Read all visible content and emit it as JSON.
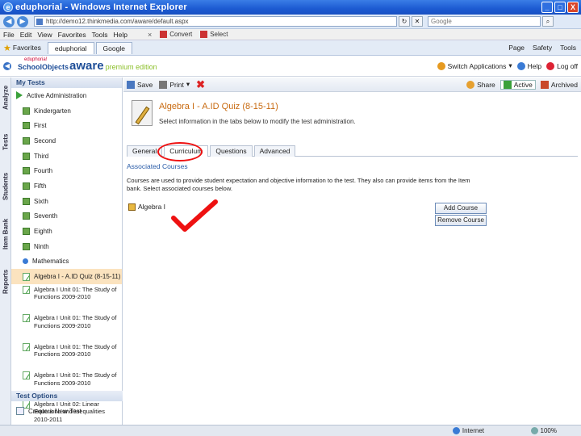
{
  "window": {
    "title": "eduphorial - Windows Internet Explorer",
    "btn_min": "_",
    "btn_max": "□",
    "btn_close": "X"
  },
  "address": {
    "url": "http://demo12.thinkmedia.com/aware/default.aspx",
    "search_placeholder": "Google"
  },
  "menu": {
    "items": [
      "File",
      "Edit",
      "View",
      "Favorites",
      "Tools",
      "Help"
    ],
    "close_x": "×",
    "convert": "Convert",
    "select": "Select"
  },
  "favorites": {
    "label": "Favorites",
    "tabs": [
      "eduphorial",
      "Google"
    ],
    "right": [
      "Page",
      "Safety",
      "Tools"
    ]
  },
  "header": {
    "logo_small": "eduphoria!",
    "logo_school": "SchoolObjects",
    "logo_aware": "aware",
    "logo_edition": "premium edition",
    "switch_apps": "Switch Applications",
    "help": "Help",
    "logoff": "Log off"
  },
  "vtabs": [
    "Analyze",
    "Tests",
    "Students",
    "Item Bank",
    "Reports"
  ],
  "sidebar": {
    "title": "My Tests",
    "active": "Active Administration",
    "folders": [
      "Kindergarten",
      "First",
      "Second",
      "Third",
      "Fourth",
      "Fifth",
      "Sixth",
      "Seventh",
      "Eighth",
      "Ninth"
    ],
    "subject": "Mathematics",
    "quizzes": [
      "Algebra I - A.ID Quiz (8-15-11)",
      "Algebra I Unit 01: The Study of Functions 2009-2010",
      "Algebra I Unit 01: The Study of Functions 2009-2010",
      "Algebra I Unit 01: The Study of Functions 2009-2010",
      "Algebra I Unit 01: The Study of Functions 2009-2010",
      "Algebra I Unit 02: Linear Equations and Inequalities 2010-2011"
    ],
    "options_title": "Test Options",
    "create": "Create a New Test"
  },
  "toolbar": {
    "save": "Save",
    "print": "Print",
    "share": "Share",
    "active": "Active",
    "archived": "Archived"
  },
  "main": {
    "test_title": "Algebra I - A.ID Quiz (8-15-11)",
    "subtitle": "Select information in the tabs below to modify the test administration.",
    "tabs": [
      "General",
      "Curriculum",
      "Questions",
      "Advanced"
    ],
    "section_title": "Associated Courses",
    "description": "Courses are used to provide student expectation and objective information to the test. They also can provide items from the Item bank. Select associated courses below.",
    "course": "Algebra I",
    "add_course": "Add Course",
    "remove_course": "Remove Course"
  },
  "status": {
    "zone": "Internet",
    "zoom": "100%"
  },
  "colors": {
    "accent": "#1c5ad2",
    "title_orange": "#c86a10",
    "check_red": "#e11",
    "selected_row": "#fbe3bf"
  }
}
